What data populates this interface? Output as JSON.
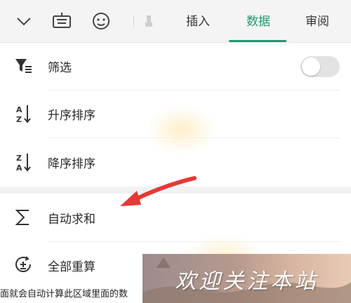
{
  "toolbar": {
    "icons": [
      "chevron-down-icon",
      "keyboard-icon",
      "smiley-icon",
      "brush-icon"
    ],
    "tabs": [
      {
        "label": "插入",
        "active": false
      },
      {
        "label": "数据",
        "active": true
      },
      {
        "label": "审阅",
        "active": false
      }
    ]
  },
  "menu": {
    "filter": {
      "label": "筛选",
      "icon": "filter-icon",
      "toggle_on": false
    },
    "sort_asc": {
      "label": "升序排序",
      "icon": "sort-ascending-icon"
    },
    "sort_desc": {
      "label": "降序排序",
      "icon": "sort-descending-icon"
    },
    "auto_sum": {
      "label": "自动求和",
      "icon": "sigma-icon"
    },
    "recalc": {
      "label": "全部重算",
      "icon": "recalculate-icon"
    }
  },
  "caption": "面就会自动计算此区域里面的数",
  "watermark": "欢迎关注本站",
  "colors": {
    "accent": "#1f9a6d",
    "arrow": "#e53935"
  }
}
